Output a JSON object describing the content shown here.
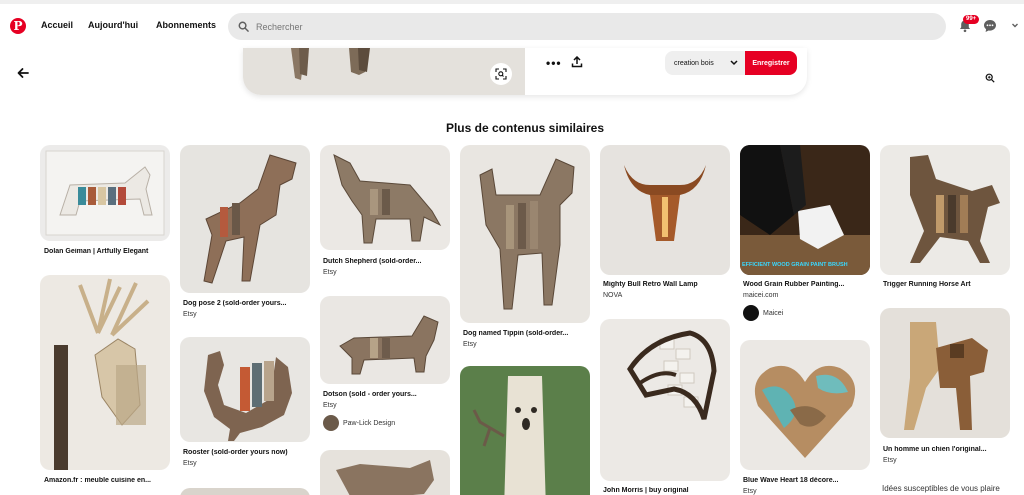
{
  "header": {
    "nav": [
      "Accueil",
      "Aujourd'hui",
      "Abonnements"
    ],
    "search_placeholder": "Rechercher",
    "notifications_badge": "99+"
  },
  "pin_actions": {
    "board_name": "creation bois",
    "save_label": "Enregistrer"
  },
  "section_title": "Plus de contenus similaires",
  "pins": [
    {
      "title": "Dolan Geiman | Artfully Elegant",
      "source": ""
    },
    {
      "title": "Dog pose 2 (sold-order yours...",
      "source": "Etsy"
    },
    {
      "title": "Dutch Shepherd (sold-order...",
      "source": "Etsy"
    },
    {
      "title": "Dog named Tippin (sold-order...",
      "source": "Etsy"
    },
    {
      "title": "Mighty Bull Retro Wall Lamp",
      "source": "NOVA"
    },
    {
      "title": "Wood Grain Rubber Painting...",
      "source": "maicei.com",
      "overlay_text": "EFFICIENT WOOD GRAIN PAINT BRUSH",
      "creator": "Maicei"
    },
    {
      "title": "Trigger Running Horse Art",
      "source": ""
    },
    {
      "title": "Amazon.fr : meuble cuisine en...",
      "source": ""
    },
    {
      "title": "Rooster (sold-order yours now)",
      "source": "Etsy"
    },
    {
      "title": "Dotson (sold - order yours...",
      "source": "Etsy",
      "creator": "Paw-Lick Design"
    },
    {
      "title": "John Morris | buy original",
      "source": ""
    },
    {
      "title": "Blue Wave Heart 18 décore...",
      "source": "Etsy"
    },
    {
      "title": "Un homme un chien l'original...",
      "source": "Etsy"
    }
  ],
  "ideas_label": "Idées susceptibles de vous plaire"
}
